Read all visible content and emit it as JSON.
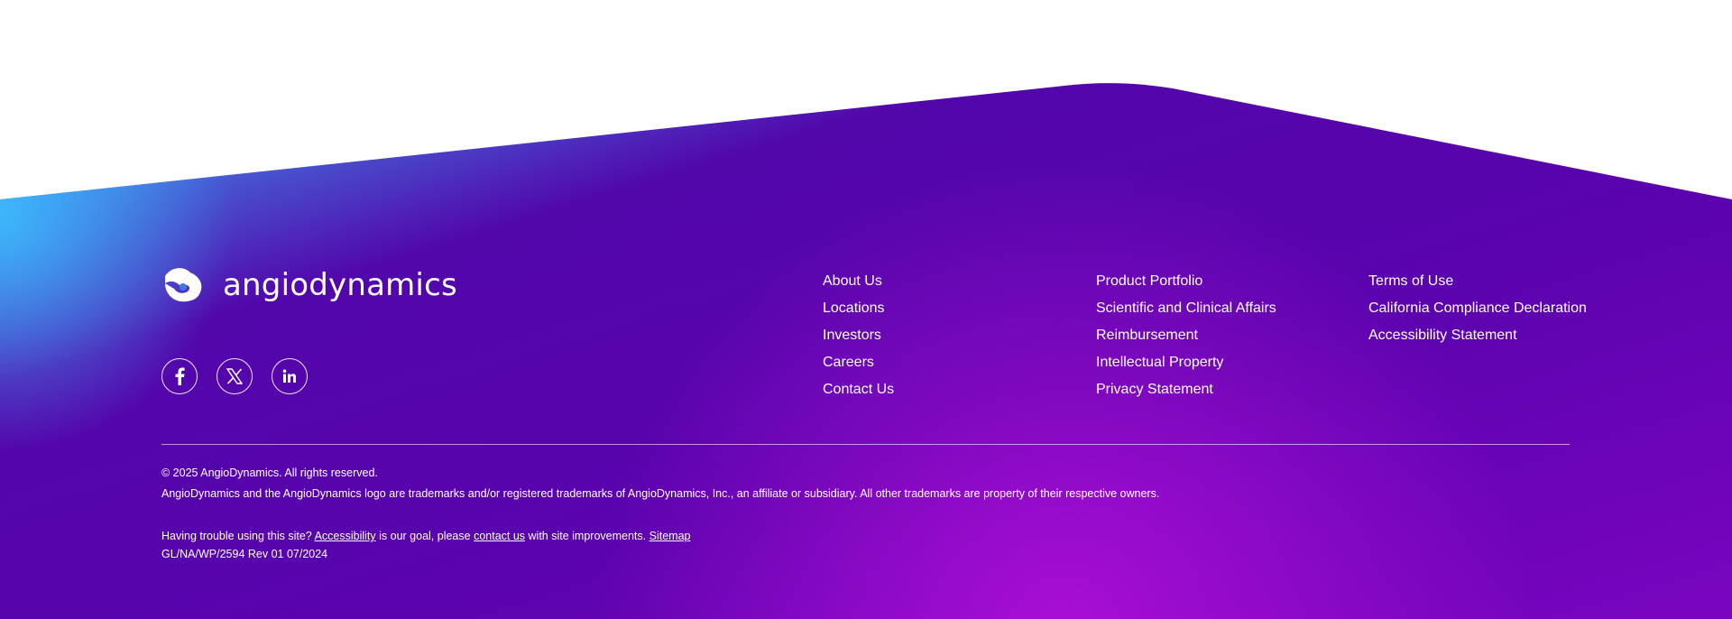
{
  "brand": {
    "name": "angiodynamics",
    "gradient_start": "#3ab6ff",
    "gradient_mid": "#5402a8",
    "gradient_end": "#9a0ccf"
  },
  "social": [
    {
      "icon": "facebook-icon",
      "label": "Facebook"
    },
    {
      "icon": "x-twitter-icon",
      "label": "X"
    },
    {
      "icon": "linkedin-icon",
      "label": "LinkedIn"
    }
  ],
  "nav": {
    "col1": [
      "About Us",
      "Locations",
      "Investors",
      "Careers",
      "Contact Us"
    ],
    "col2": [
      "Product Portfolio",
      "Scientific and Clinical Affairs",
      "Reimbursement",
      "Intellectual Property",
      "Privacy Statement"
    ],
    "col3": [
      "Terms of Use",
      "California Compliance Declaration",
      "Accessibility Statement"
    ]
  },
  "legal": {
    "copyright": "© 2025 AngioDynamics. All rights reserved.",
    "trademark": "AngioDynamics and the AngioDynamics logo are trademarks and/or registered trademarks of AngioDynamics, Inc., an affiliate or subsidiary. All other trademarks are property of their respective owners.",
    "help_prefix": "Having trouble using this site?",
    "accessibility_link": "Accessibility",
    "help_middle": "is our goal, please",
    "contact_link": "contact us",
    "help_suffix": "with site improvements.",
    "sitemap_link": "Sitemap",
    "revision": "GL/NA/WP/2594 Rev 01 07/2024"
  }
}
